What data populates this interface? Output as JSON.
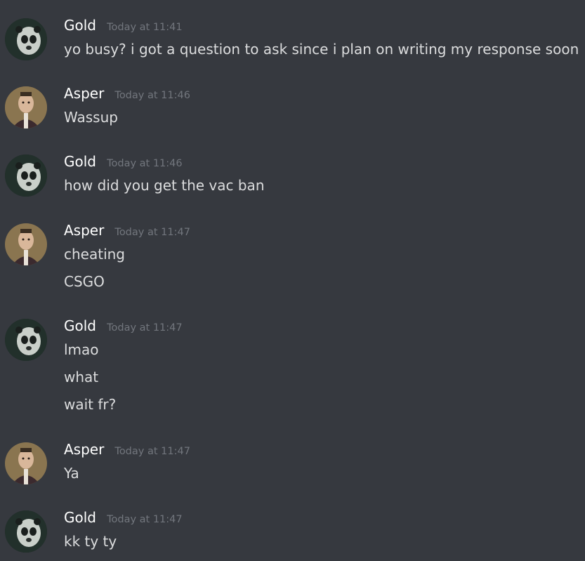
{
  "groups": [
    {
      "author": "Gold",
      "avatar": "panda-mask-avatar-icon",
      "timestamp": "Today at 11:41",
      "lines": [
        "yo busy? i got a question to ask since i plan on writing my response soon"
      ]
    },
    {
      "author": "Asper",
      "avatar": "portrait-avatar-icon",
      "timestamp": "Today at 11:46",
      "lines": [
        "Wassup"
      ]
    },
    {
      "author": "Gold",
      "avatar": "panda-mask-avatar-icon",
      "timestamp": "Today at 11:46",
      "lines": [
        "how did you get the vac ban"
      ]
    },
    {
      "author": "Asper",
      "avatar": "portrait-avatar-icon",
      "timestamp": "Today at 11:47",
      "lines": [
        "cheating",
        "CSGO"
      ]
    },
    {
      "author": "Gold",
      "avatar": "panda-mask-avatar-icon",
      "timestamp": "Today at 11:47",
      "lines": [
        "lmao",
        "what",
        "wait fr?"
      ]
    },
    {
      "author": "Asper",
      "avatar": "portrait-avatar-icon",
      "timestamp": "Today at 11:47",
      "lines": [
        "Ya"
      ]
    },
    {
      "author": "Gold",
      "avatar": "panda-mask-avatar-icon",
      "timestamp": "Today at 11:47",
      "lines": [
        "kk ty ty"
      ]
    }
  ],
  "colors": {
    "background": "#36393f",
    "username": "#ffffff",
    "timestamp": "#72767d",
    "message_text": "#dcddde"
  }
}
